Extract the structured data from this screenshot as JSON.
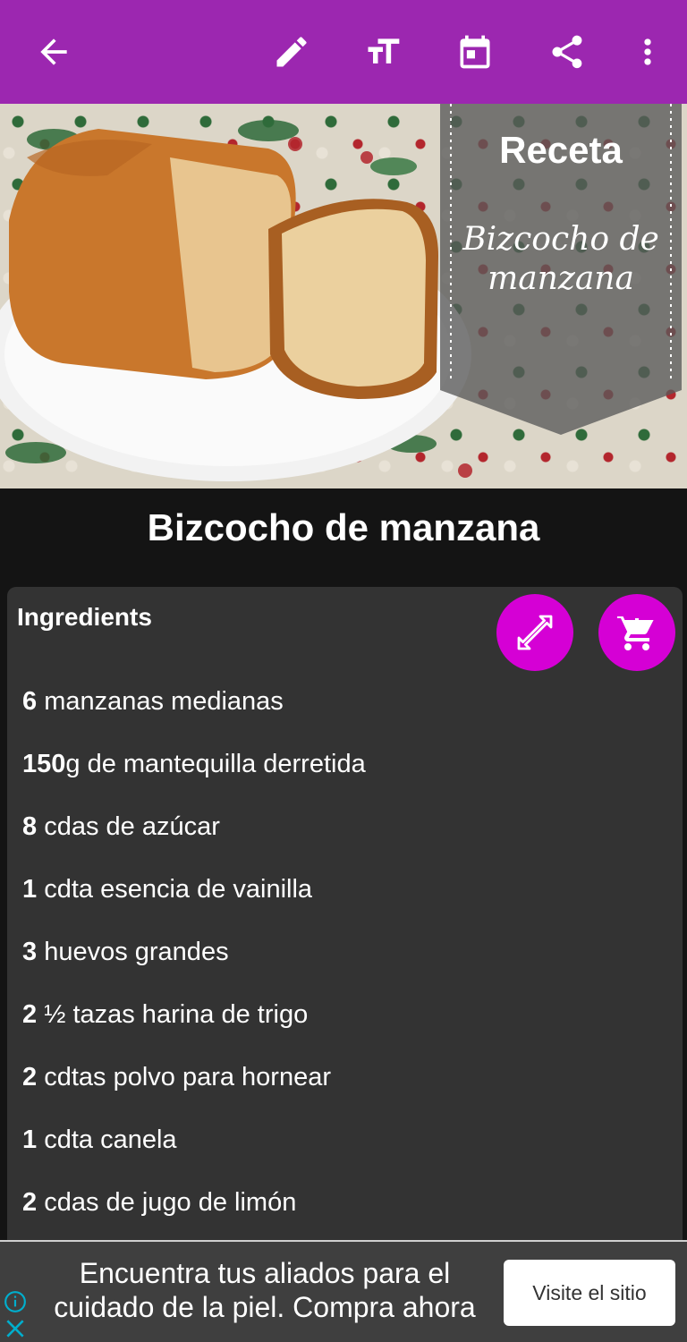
{
  "toolbar": {
    "icons": [
      "back-arrow-icon",
      "edit-pencil-icon",
      "text-size-icon",
      "calendar-icon",
      "share-icon",
      "more-vert-icon"
    ],
    "color": "#9c27b0"
  },
  "hero": {
    "banner_kicker": "Receta",
    "banner_title": "Bizcocho de manzana"
  },
  "recipe": {
    "title": "Bizcocho de manzana"
  },
  "ingredients": {
    "heading": "Ingredients",
    "fab_color": "#d500d5",
    "items": [
      {
        "qty": "6",
        "text": " manzanas medianas"
      },
      {
        "qty": "150",
        "text": "g de mantequilla derretida"
      },
      {
        "qty": "8",
        "text": " cdas de azúcar"
      },
      {
        "qty": "1",
        "text": " cdta esencia de vainilla"
      },
      {
        "qty": "3",
        "text": " huevos grandes"
      },
      {
        "qty": "2",
        "text": " ½ tazas harina de trigo"
      },
      {
        "qty": "2",
        "text": " cdtas polvo para hornear"
      },
      {
        "qty": "1",
        "text": " cdta canela"
      },
      {
        "qty": "2",
        "text": " cdas de jugo de limón"
      }
    ]
  },
  "ad": {
    "text": "Encuentra tus aliados para el cuidado de la piel. Compra ahora",
    "button_label": "Visite el sitio"
  }
}
